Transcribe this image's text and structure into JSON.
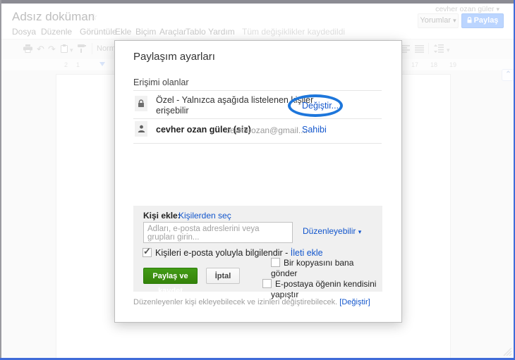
{
  "window": {
    "doc_title": "Adsız doküman",
    "menu_items": [
      "Dosya",
      "Düzenle",
      "Görüntüle",
      "Ekle",
      "Biçim",
      "Araçlar",
      "Tablo",
      "Yardım"
    ],
    "save_status": "Tüm değişiklikler kaydedildi",
    "account_name": "cevher ozan güler",
    "comments_button": "Yorumlar",
    "share_button": "Paylaş",
    "styles_dropdown": "Normal",
    "ruler_left_numbers": [
      "2",
      "1"
    ],
    "ruler_right_numbers": [
      "17",
      "18",
      "19"
    ]
  },
  "dialog": {
    "title": "Paylaşım ayarları",
    "access_heading": "Erişimi olanlar",
    "row_private": {
      "text": "Özel - Yalnızca aşağıda listelenen kişiler erişebilir",
      "action": "Değiştir..."
    },
    "row_owner": {
      "name": "cevher ozan güler (siz)",
      "email": "cevherozan@gmail....",
      "action": "Sahibi"
    },
    "add_people": {
      "label": "Kişi ekle:",
      "choose_link": "Kişilerden seç",
      "input_placeholder": "Adları, e-posta adreslerini veya grupları girin...",
      "permission_dropdown": "Düzenleyebilir",
      "notify_label": "Kişileri e-posta yoluyla bilgilendir -",
      "notify_link": "İleti ekle",
      "copy_to_me_label": "Bir kopyasını bana gönder",
      "paste_item_label": "E-postaya öğenin kendisini yapıştır",
      "share_save_button": "Paylaş ve kaydet",
      "cancel_button": "İptal"
    },
    "footer": {
      "text": "Düzenleyenler kişi ekleyebilecek ve izinleri değiştirebilecek.",
      "link": "[Değiştir]"
    }
  },
  "icons": {
    "dropdown_arrow": "▾",
    "star": "☆",
    "undo": "↶",
    "redo": "↷",
    "check": "✓",
    "scroll_up": "⌃"
  },
  "colors": {
    "link_blue": "#1155cc",
    "share_button_blue": "#4d90fe",
    "annotation_blue": "#1d76db",
    "confirm_green": "#3a8e10",
    "frame_blue": "#3f6bd8"
  }
}
